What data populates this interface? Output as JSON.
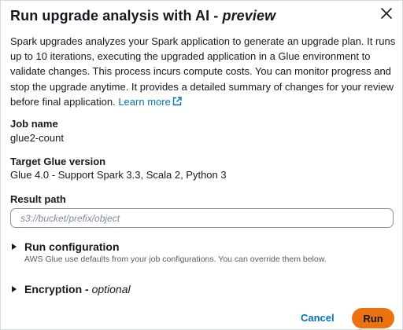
{
  "modal": {
    "title": "Run upgrade analysis with AI -",
    "title_suffix": "preview",
    "close_icon": "close-icon",
    "description": "Spark upgrades analyzes your Spark application to generate an upgrade plan. It runs up to 10 iterations, executing the upgraded application in a Glue environment to validate changes. This process incurs compute costs. You can monitor progress and stop the upgrade anytime. It provides a detailed summary of changes for your review before final application.",
    "learn_more": "Learn more",
    "learn_more_icon": "external-link-icon",
    "accent_color": "#0073bb"
  },
  "fields": {
    "job_name_label": "Job name",
    "job_name_value": "glue2-count",
    "target_label": "Target Glue version",
    "target_value": "Glue 4.0 - Support Spark 3.3, Scala 2, Python 3",
    "result_path_label": "Result path",
    "result_path_placeholder": "s3://bucket/prefix/object",
    "result_path_value": ""
  },
  "run_config": {
    "title": "Run configuration",
    "description": "AWS Glue use defaults from your job configurations. You can override them below.",
    "icon": "caret-right-icon"
  },
  "encryption": {
    "title": "Encryption -",
    "optional": "optional",
    "icon": "caret-right-icon"
  },
  "footer": {
    "cancel_label": "Cancel",
    "run_label": "Run",
    "run_color": "#ec7211"
  }
}
